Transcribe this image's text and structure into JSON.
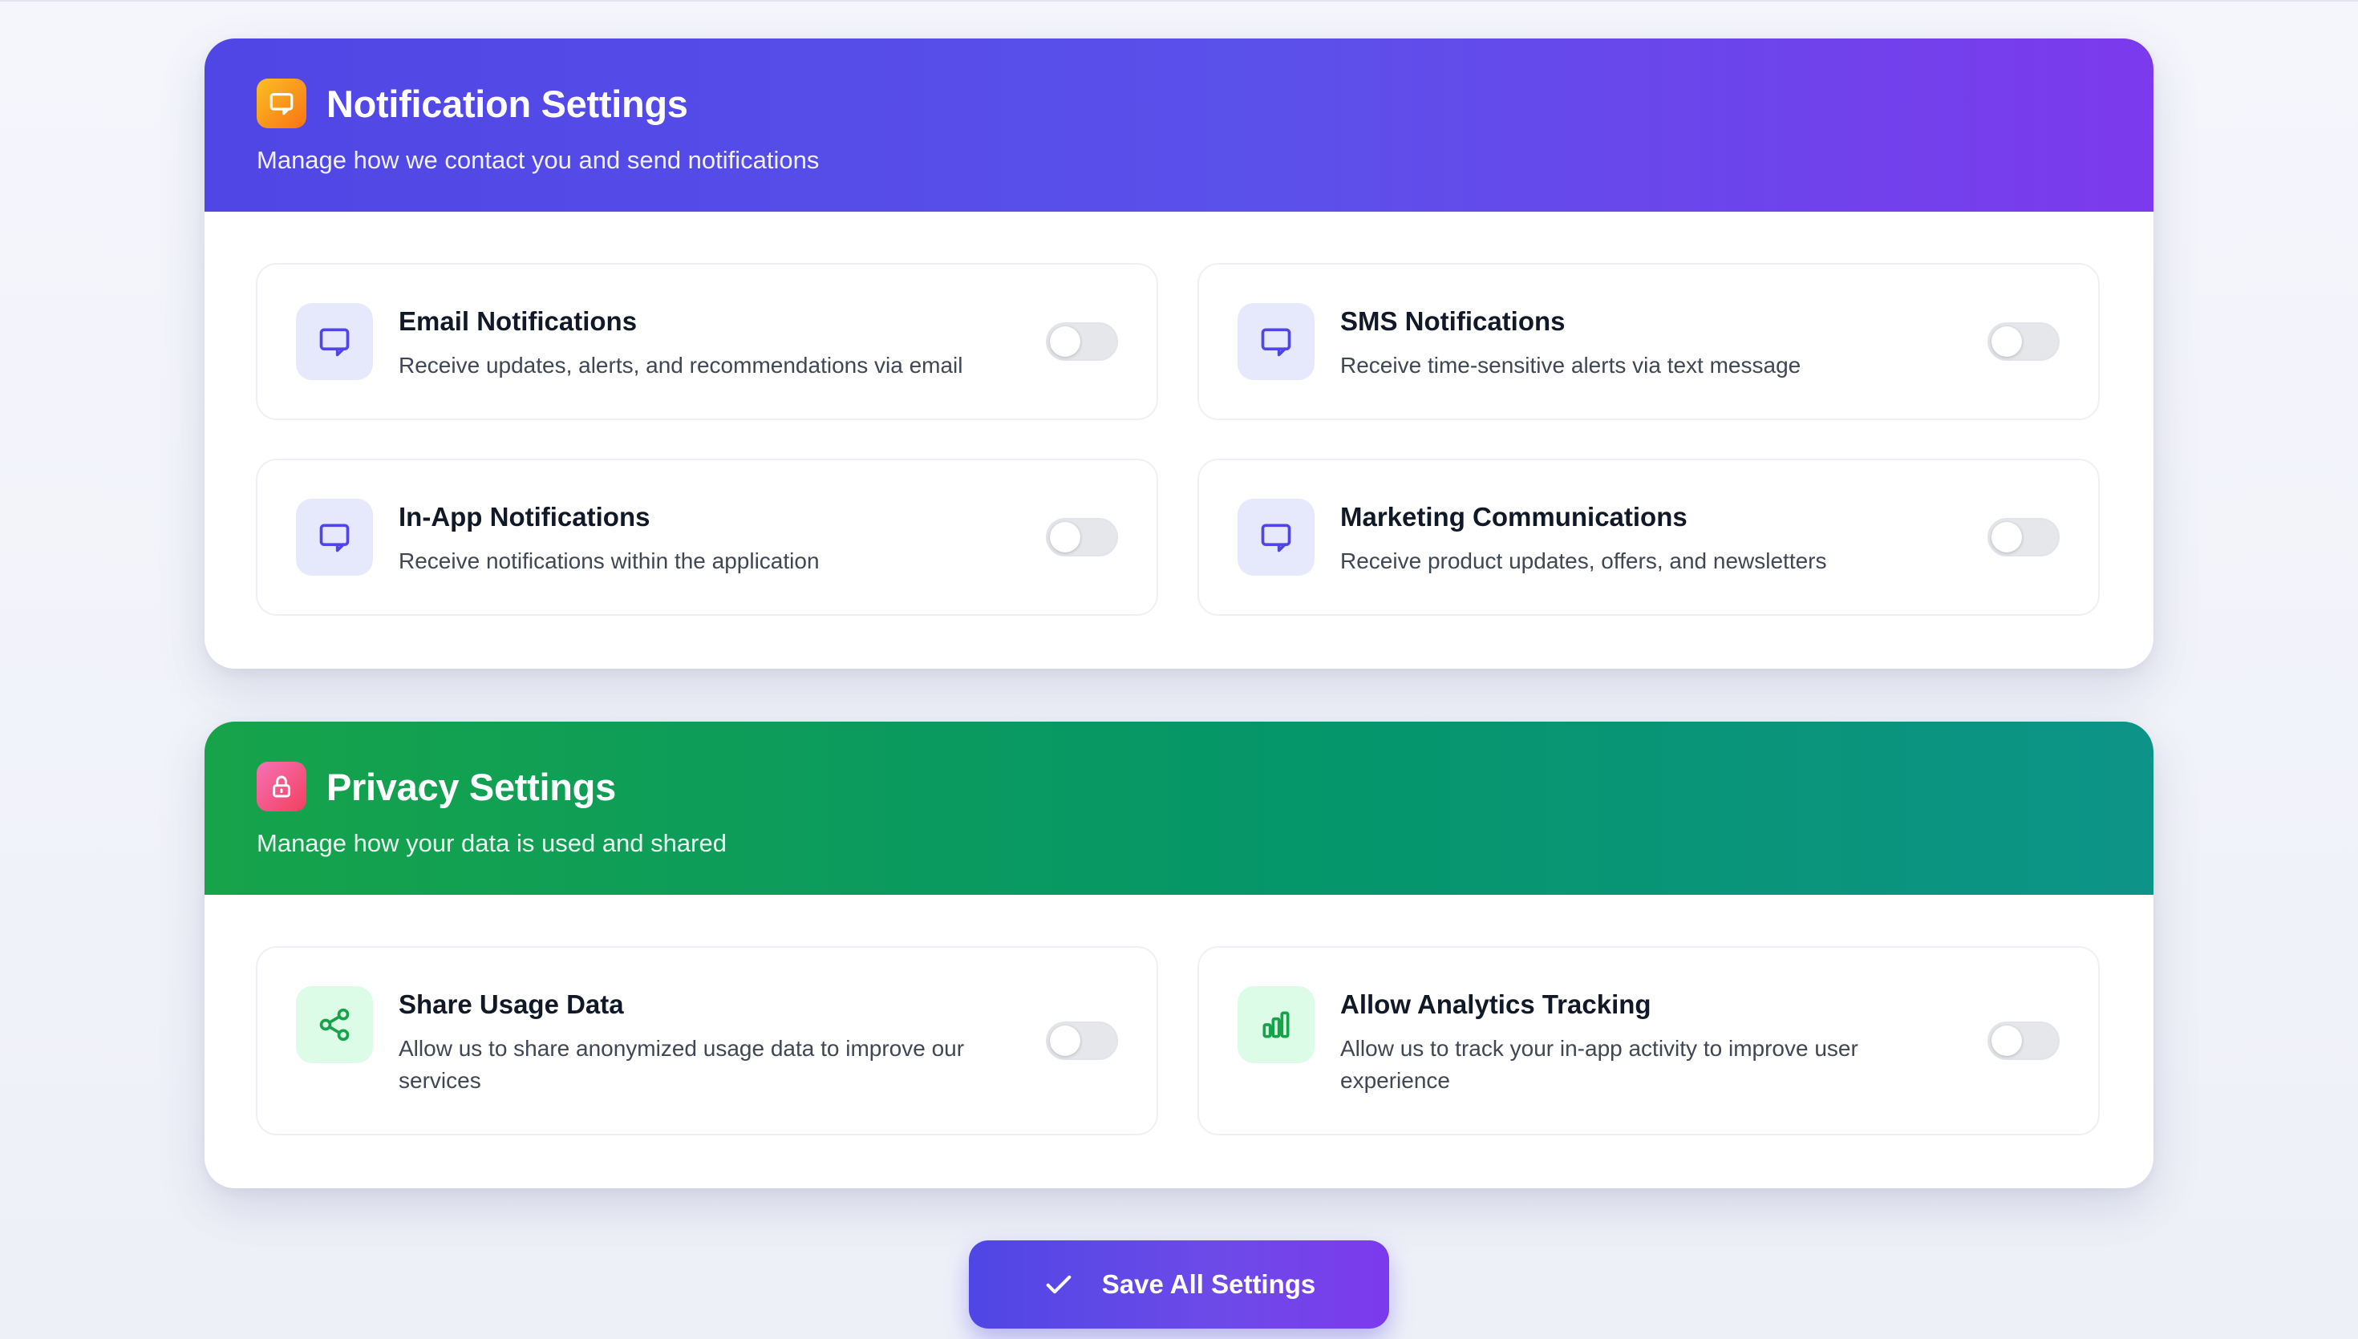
{
  "notification_section": {
    "title": "Notification Settings",
    "subtitle": "Manage how we contact you and send notifications",
    "icon": "message-square-icon",
    "accent": "#4f46e5",
    "items": [
      {
        "title": "Email Notifications",
        "description": "Receive updates, alerts, and recommendations via email",
        "icon": "message-square-icon",
        "enabled": false
      },
      {
        "title": "SMS Notifications",
        "description": "Receive time-sensitive alerts via text message",
        "icon": "message-square-icon",
        "enabled": false
      },
      {
        "title": "In-App Notifications",
        "description": "Receive notifications within the application",
        "icon": "message-square-icon",
        "enabled": false
      },
      {
        "title": "Marketing Communications",
        "description": "Receive product updates, offers, and newsletters",
        "icon": "message-square-icon",
        "enabled": false
      }
    ]
  },
  "privacy_section": {
    "title": "Privacy Settings",
    "subtitle": "Manage how your data is used and shared",
    "icon": "lock-icon",
    "accent": "#16a34a",
    "items": [
      {
        "title": "Share Usage Data",
        "description": "Allow us to share anonymized usage data to improve our services",
        "icon": "share-icon",
        "enabled": false
      },
      {
        "title": "Allow Analytics Tracking",
        "description": "Allow us to track your in-app activity to improve user experience",
        "icon": "bar-chart-icon",
        "enabled": false
      }
    ]
  },
  "save_button": {
    "label": "Save All Settings",
    "icon": "check-icon"
  }
}
